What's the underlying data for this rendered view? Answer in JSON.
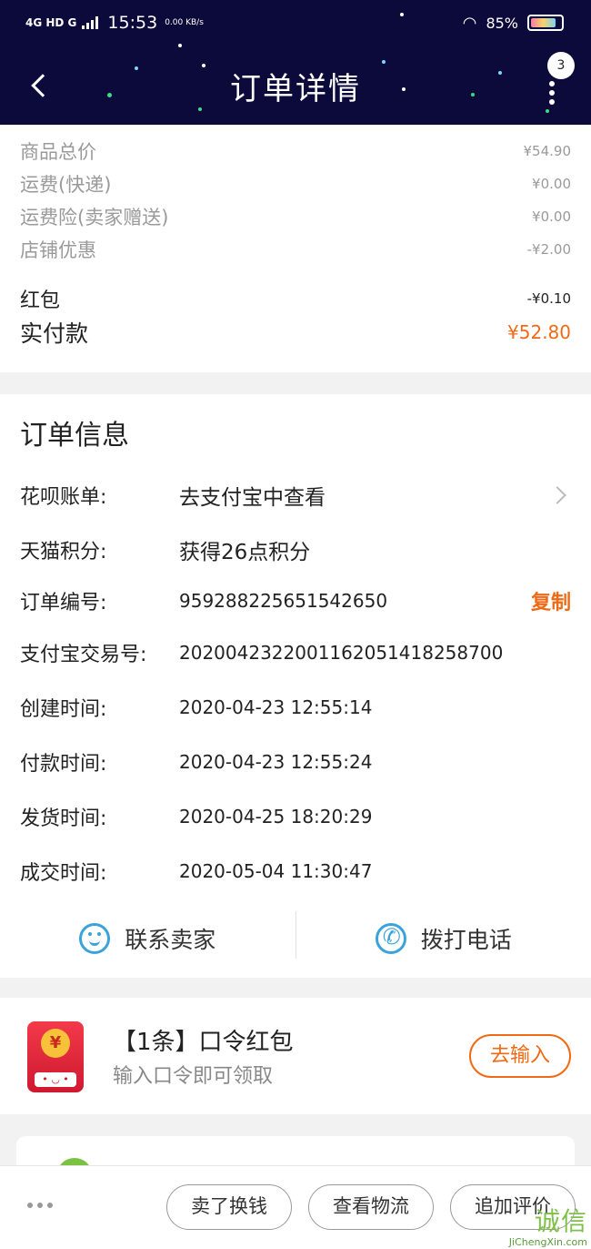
{
  "status_bar": {
    "network": "4G HD G",
    "time": "15:53",
    "speed": "0.00 KB/s",
    "battery": "85%"
  },
  "header": {
    "title": "订单详情",
    "badge_count": "3"
  },
  "price_summary": {
    "rows": [
      {
        "label": "商品总价",
        "value": "¥54.90"
      },
      {
        "label": "运费(快递)",
        "value": "¥0.00"
      },
      {
        "label": "运费险(卖家赠送)",
        "value": "¥0.00"
      },
      {
        "label": "店铺优惠",
        "value": "-¥2.00"
      }
    ],
    "red_packet": {
      "label": "红包",
      "value": "-¥0.10"
    },
    "total": {
      "label": "实付款",
      "value": "¥52.80"
    }
  },
  "order_info": {
    "title": "订单信息",
    "rows": [
      {
        "label": "花呗账单:",
        "value": "去支付宝中查看"
      },
      {
        "label": "天猫积分:",
        "value": "获得26点积分"
      },
      {
        "label": "订单编号:",
        "value": "959288225651542650"
      },
      {
        "label": "支付宝交易号:",
        "value": "2020042322001162051418258700"
      },
      {
        "label": "创建时间:",
        "value": "2020-04-23 12:55:14"
      },
      {
        "label": "付款时间:",
        "value": "2020-04-23 12:55:24"
      },
      {
        "label": "发货时间:",
        "value": "2020-04-25 18:20:29"
      },
      {
        "label": "成交时间:",
        "value": "2020-05-04 11:30:47"
      }
    ],
    "copy_label": "复制",
    "contact_seller": "联系卖家",
    "call_phone": "拨打电话"
  },
  "packet": {
    "coin": "¥",
    "title": "【1条】口令红包",
    "subtitle": "输入口令即可领取",
    "button": "去输入"
  },
  "bottom_bar": {
    "sell_label": "卖了换钱",
    "logistics_label": "查看物流",
    "review_label": "追加评价"
  },
  "watermark": {
    "text": "诚信",
    "url": "JiChengXin.com"
  },
  "colors": {
    "header_bg": "#0c0a3a",
    "accent": "#f06a16",
    "icon_blue": "#3aa3d9"
  }
}
